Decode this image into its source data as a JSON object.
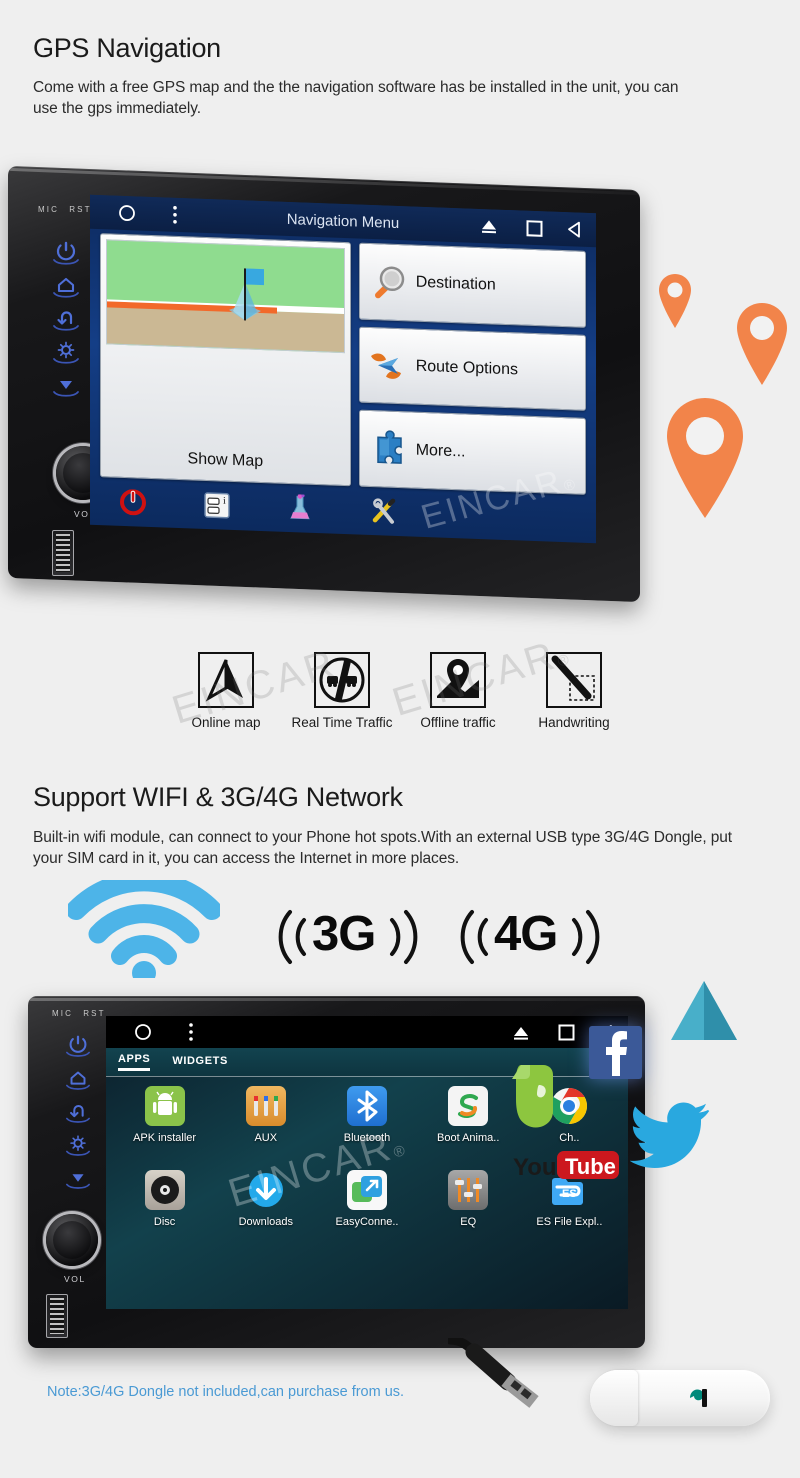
{
  "sections": {
    "gps": {
      "title": "GPS Navigation",
      "body": "Come with a free GPS map and the the navigation software has be installed in the unit, you can use the gps immediately."
    },
    "network": {
      "title": "Support WIFI & 3G/4G Network",
      "body": "Built-in wifi module, can connect to your Phone hot spots.With an external USB type 3G/4G Dongle, put your SIM card in it, you can access the Internet in more places."
    }
  },
  "nav_screen": {
    "status_title": "Navigation Menu",
    "icons": [
      "home-circle-icon",
      "menu-dots-icon",
      "eject-icon",
      "square-icon",
      "back-triangle-icon"
    ],
    "show_map_label": "Show Map",
    "buttons": [
      {
        "label": "Destination",
        "icon": "magnifier-icon"
      },
      {
        "label": "Route Options",
        "icon": "route-arrow-icon"
      },
      {
        "label": "More...",
        "icon": "puzzle-icon"
      }
    ],
    "dock_icons": [
      "power-icon",
      "traffic-info-icon",
      "flask-icon",
      "tools-icon"
    ]
  },
  "unit_controls": {
    "mic_label": "MIC",
    "rst_label": "RST",
    "vol_label": "VOL",
    "side_buttons": [
      "power-icon",
      "home-icon",
      "back-icon",
      "brightness-icon",
      "eject-icon"
    ],
    "usb_port": "usb-port"
  },
  "features": [
    {
      "label": "Online map",
      "icon": "navigation-arrow-icon"
    },
    {
      "label": "Real Time Traffic",
      "icon": "traffic-circle-icon"
    },
    {
      "label": "Offline traffic",
      "icon": "map-pin-fold-icon"
    },
    {
      "label": "Handwriting",
      "icon": "pen-writing-icon"
    }
  ],
  "network_badges": {
    "wifi": "wifi-icon",
    "g3": "3G",
    "g4": "4G"
  },
  "android_screen": {
    "tabs": [
      {
        "label": "APPS",
        "active": true
      },
      {
        "label": "WIDGETS",
        "active": false
      }
    ],
    "apps": [
      {
        "label": "APK installer",
        "icon": "android-robot-icon",
        "color": "#8bc34a"
      },
      {
        "label": "AUX",
        "icon": "aux-plugs-icon",
        "color": "#e8a33d"
      },
      {
        "label": "Bluetooth",
        "icon": "bluetooth-icon",
        "color": "#2f8fe0"
      },
      {
        "label": "Boot Anima..",
        "icon": "sogou-s-icon",
        "color": "#f2f2f2"
      },
      {
        "label": "Ch..",
        "icon": "chrome-icon",
        "color": "#ffffff"
      },
      {
        "label": "Disc",
        "icon": "disc-icon",
        "color": "#c9c3ba"
      },
      {
        "label": "Downloads",
        "icon": "download-arrow-icon",
        "color": "#23a9ea"
      },
      {
        "label": "EasyConne..",
        "icon": "easyconnect-icon",
        "color": "#ffffff"
      },
      {
        "label": "EQ",
        "icon": "equalizer-icon",
        "color": "#8d8d8d"
      },
      {
        "label": "ES File Expl..",
        "icon": "es-file-explorer-icon",
        "color": "#3fa9f5"
      }
    ]
  },
  "social_icons": [
    {
      "name": "google-play-triangle-icon",
      "color": "#39a9c4"
    },
    {
      "name": "facebook-icon",
      "color": "#3b5998"
    },
    {
      "name": "evernote-icon",
      "color": "#8dc63f"
    },
    {
      "name": "youtube-icon",
      "color": "#cc181e"
    },
    {
      "name": "twitter-icon",
      "color": "#29a8df"
    }
  ],
  "note": "Note:3G/4G Dongle not included,can purchase from us.",
  "dongle": {
    "name": "usb-3g-dongle",
    "logo_color": "#00897b"
  },
  "watermark": {
    "text": "EINCAR",
    "mark": "®"
  },
  "colors": {
    "accent_orange": "#f2844a",
    "note_blue": "#4a9ad4",
    "wifi_blue": "#4db4e8",
    "screen_blue": "#143e86",
    "page_bg": "#efefef"
  },
  "map_pins": [
    {
      "size": "small"
    },
    {
      "size": "medium"
    },
    {
      "size": "large"
    }
  ]
}
